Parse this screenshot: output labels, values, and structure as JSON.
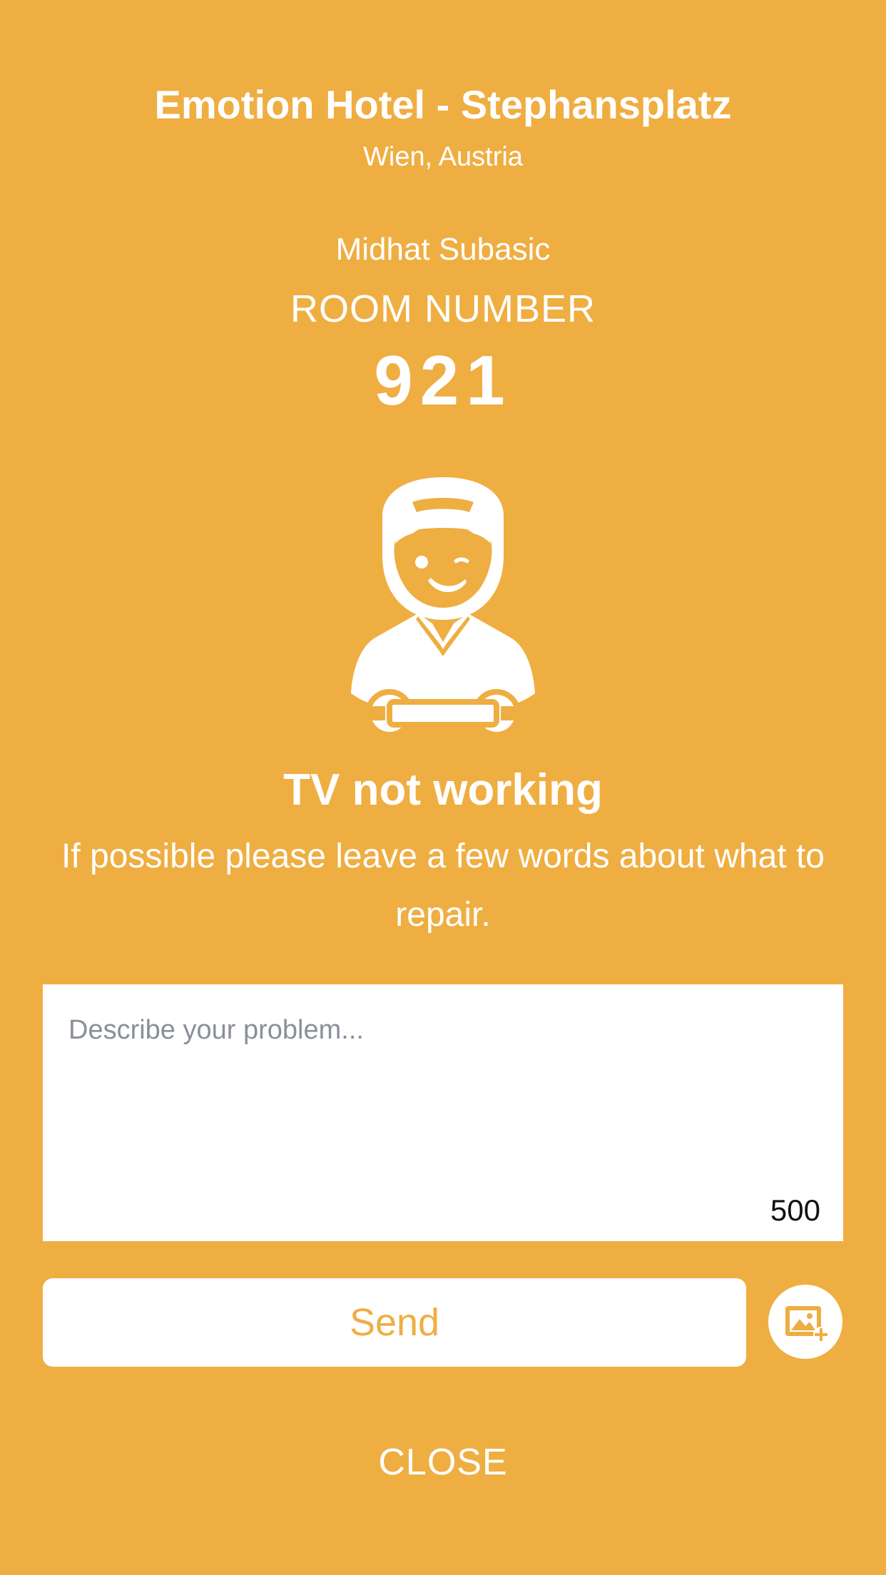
{
  "header": {
    "hotel_name": "Emotion Hotel - Stephansplatz",
    "location": "Wien, Austria"
  },
  "guest": {
    "name": "Midhat Subasic",
    "room_label": "ROOM NUMBER",
    "room_number": "921"
  },
  "issue": {
    "icon": "repairman-icon",
    "title": "TV not working",
    "instruction": "If possible please leave a few words about what to repair."
  },
  "form": {
    "placeholder": "Describe your problem...",
    "value": "",
    "char_limit": "500",
    "send_label": "Send",
    "photo_icon": "add-photo-icon"
  },
  "footer": {
    "close_label": "CLOSE"
  },
  "colors": {
    "background": "#EFAE42",
    "foreground": "#FFFFFF",
    "placeholder": "#8A8F99"
  }
}
